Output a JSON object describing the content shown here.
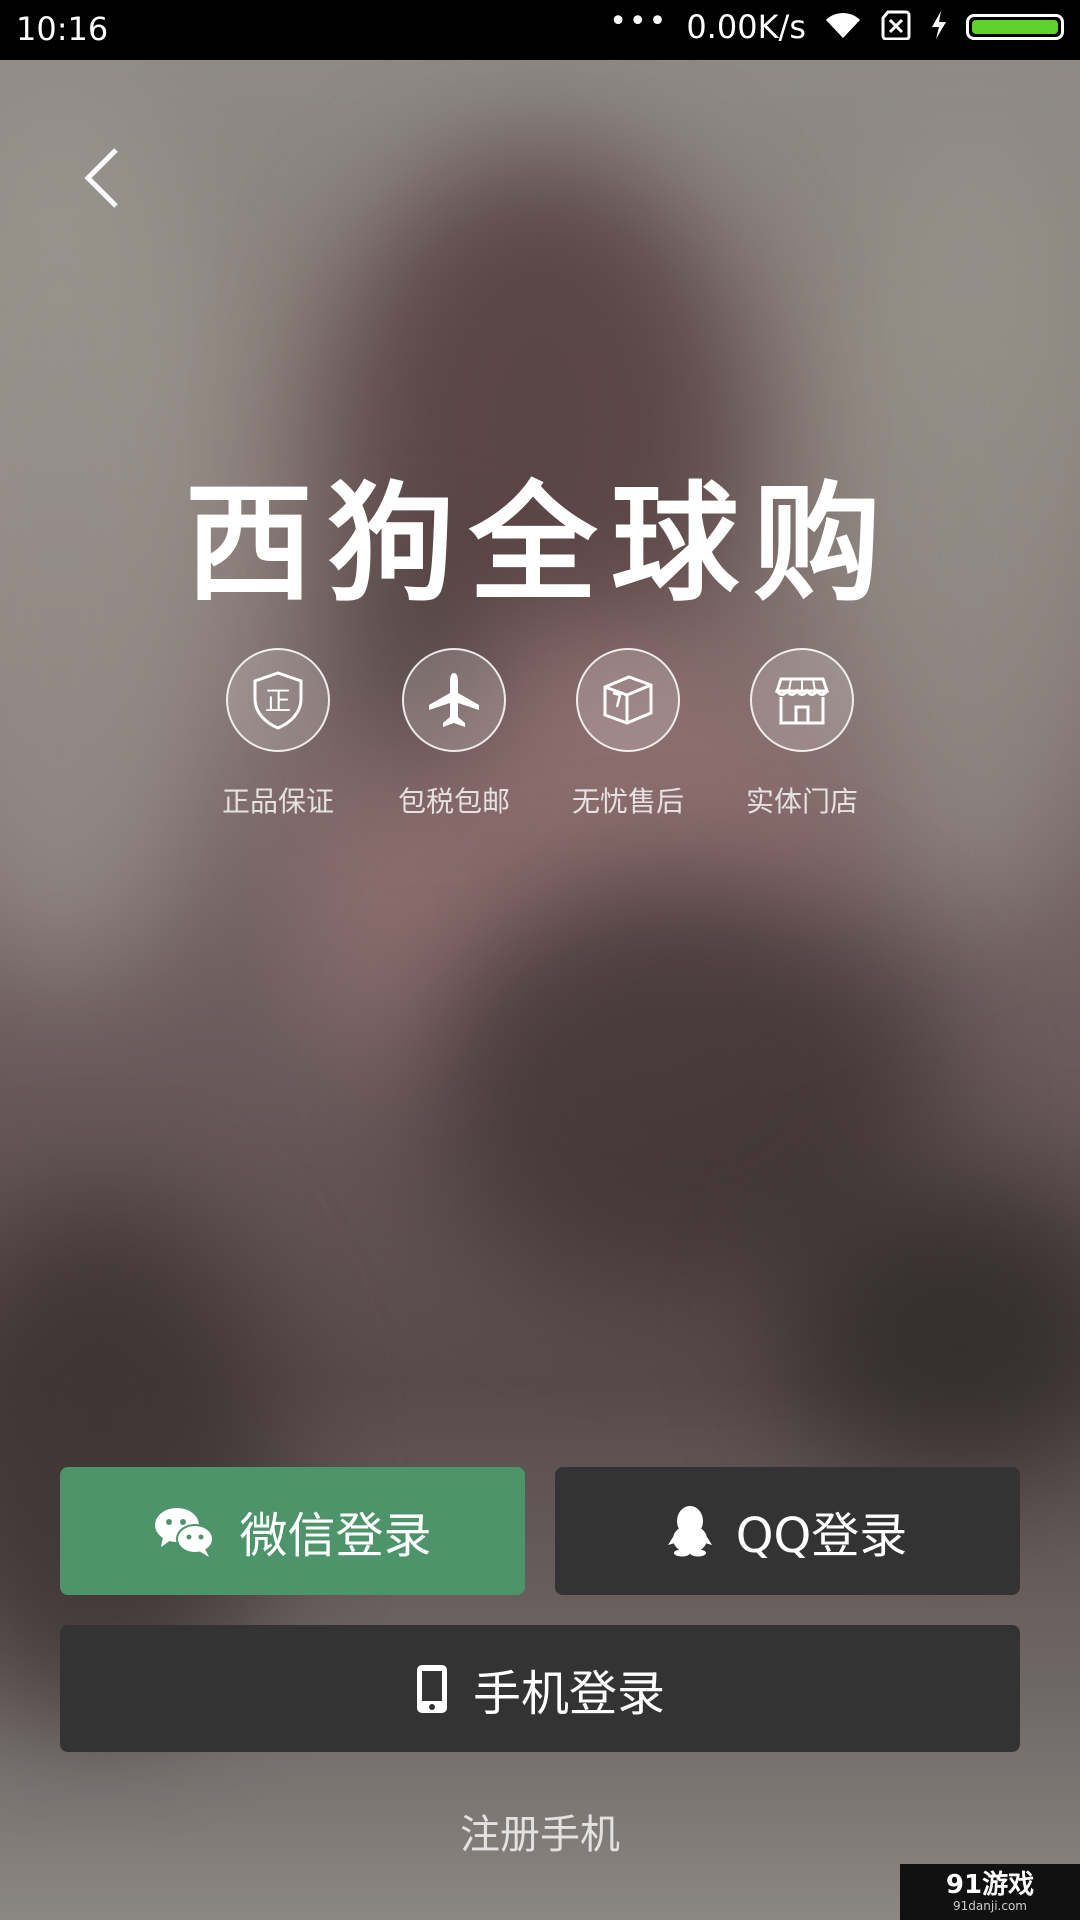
{
  "status_bar": {
    "time": "10:16",
    "dots": "•••",
    "network_speed": "0.00K/s",
    "icons": [
      "wifi-icon",
      "sim-blocked-icon",
      "charging-icon",
      "battery-icon"
    ],
    "battery_color": "#5ed12b"
  },
  "header": {
    "back_icon": "chevron-left-icon"
  },
  "brand": {
    "title": "西狗全球购"
  },
  "features": [
    {
      "icon": "shield-icon",
      "icon_text": "正",
      "label": "正品保证"
    },
    {
      "icon": "airplane-icon",
      "label": "包税包邮"
    },
    {
      "icon": "box-icon",
      "label": "无忧售后"
    },
    {
      "icon": "store-icon",
      "label": "实体门店"
    }
  ],
  "login": {
    "wechat_label": "微信登录",
    "wechat_icon": "wechat-icon",
    "wechat_color": "#4e946a",
    "qq_label": "QQ登录",
    "qq_icon": "qq-penguin-icon",
    "phone_label": "手机登录",
    "phone_icon": "phone-icon",
    "dark_button_color": "#333333"
  },
  "register_label": "注册手机",
  "watermark": {
    "brand": "91游戏",
    "domain": "91danji.com"
  }
}
